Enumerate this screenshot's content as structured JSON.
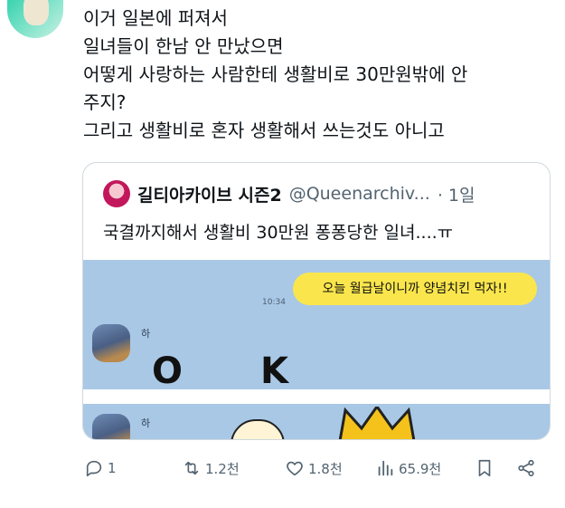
{
  "tweet": {
    "lines": [
      "이거 일본에 퍼져서",
      "일녀들이 한남 안 만났으면",
      "어떻게 사랑하는 사람한테 생활비로 30만원밖에 안",
      "주지?",
      "그리고 생활비로 혼자 생활해서 쓰는것도 아니고"
    ]
  },
  "quote": {
    "name": "길티아카이브 시즌2",
    "handle": "@Queenarchiv...",
    "time": "· 1일",
    "text": "국결까지해서 생활비 30만원 퐁퐁당한 일녀....ㅠ",
    "chat": {
      "bubble": "오늘 월급날이니까 양념치킨 먹자!!",
      "time": "10:34",
      "sender": "하",
      "letter_1": "O",
      "letter_2": "K"
    }
  },
  "actions": {
    "replies": "1",
    "retweets": "1.2천",
    "likes": "1.8천",
    "views": "65.9천"
  }
}
